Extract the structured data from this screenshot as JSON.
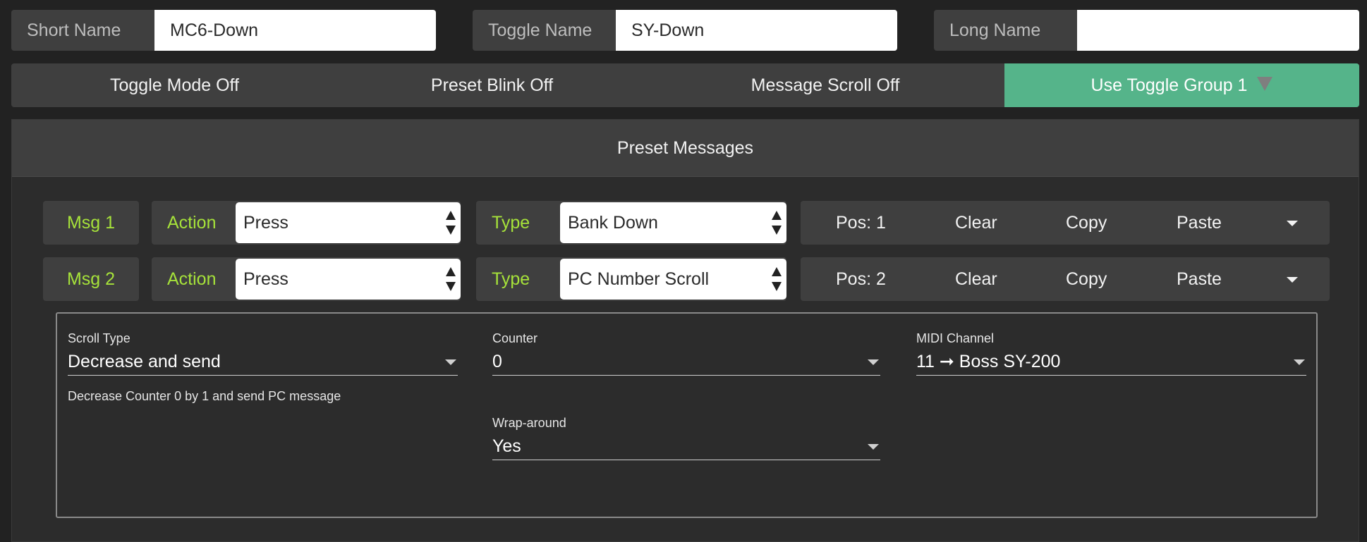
{
  "names": {
    "short": {
      "label": "Short Name",
      "value": "MC6-Down"
    },
    "toggle": {
      "label": "Toggle Name",
      "value": "SY-Down"
    },
    "long": {
      "label": "Long Name",
      "value": ""
    }
  },
  "modes": {
    "toggle_mode": "Toggle Mode Off",
    "preset_blink": "Preset Blink Off",
    "message_scroll": "Message Scroll Off",
    "toggle_group": "Use Toggle Group 1"
  },
  "panel": {
    "title": "Preset Messages"
  },
  "messages": [
    {
      "msg": "Msg 1",
      "action_label": "Action",
      "action": "Press",
      "type_label": "Type",
      "type": "Bank Down",
      "pos": "Pos: 1",
      "clear": "Clear",
      "copy": "Copy",
      "paste": "Paste"
    },
    {
      "msg": "Msg 2",
      "action_label": "Action",
      "action": "Press",
      "type_label": "Type",
      "type": "PC Number Scroll",
      "pos": "Pos: 2",
      "clear": "Clear",
      "copy": "Copy",
      "paste": "Paste"
    }
  ],
  "detail": {
    "scroll_type": {
      "label": "Scroll Type",
      "value": "Decrease and send",
      "helper": "Decrease Counter 0 by 1 and send PC message"
    },
    "counter": {
      "label": "Counter",
      "value": "0"
    },
    "midi_channel": {
      "label": "MIDI Channel",
      "value": "11 ➞ Boss SY-200"
    },
    "wrap_around": {
      "label": "Wrap-around",
      "value": "Yes"
    }
  },
  "colors": {
    "accent_green": "#55b48a",
    "label_green": "#a6e23a",
    "background": "#222222",
    "panel": "#3f3f3f"
  },
  "icons": {
    "toggle_group_dropdown": "triangle-down-icon",
    "select_stepper": "up-down-arrows-icon",
    "menu_caret": "caret-down-icon"
  }
}
